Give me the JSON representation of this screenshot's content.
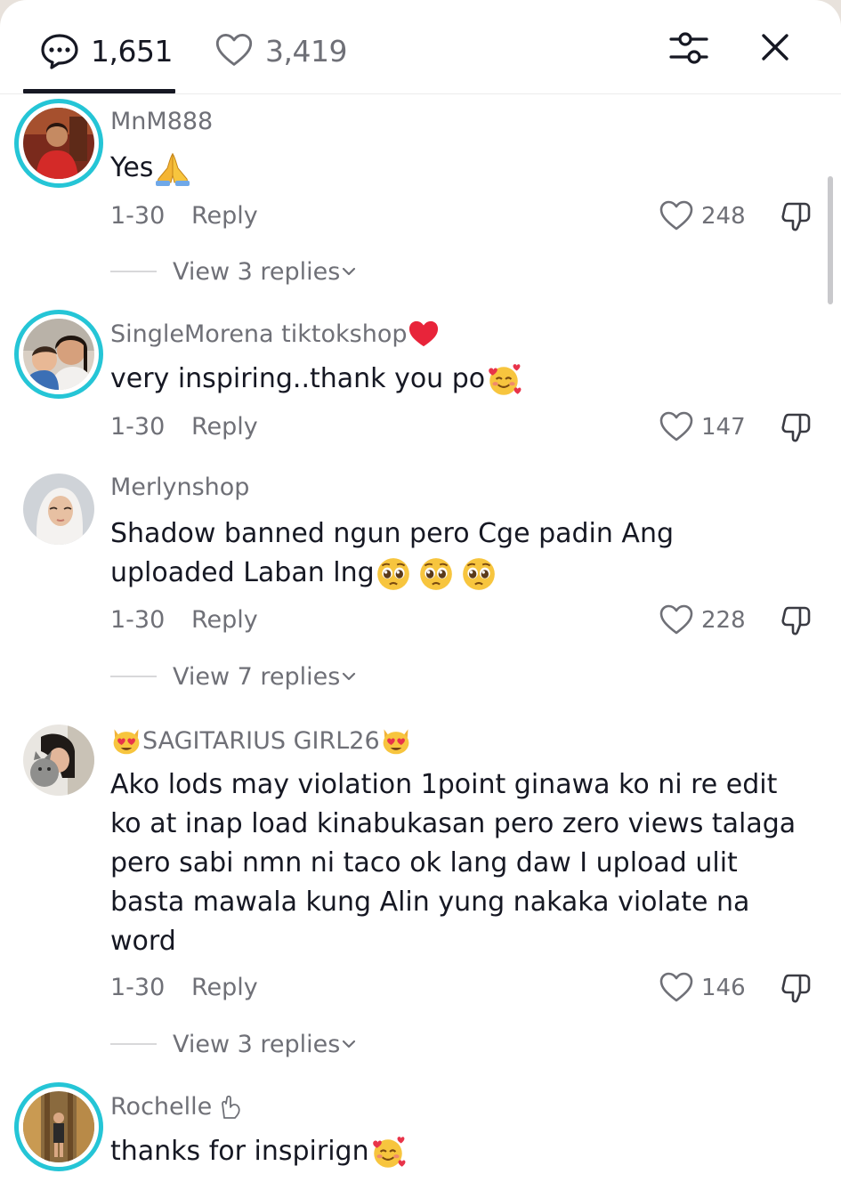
{
  "header": {
    "comments_count": "1,651",
    "likes_count": "3,419",
    "icons": {
      "comments": "comment-bubble-icon",
      "likes": "heart-icon",
      "filter": "sliders-icon",
      "close": "close-icon"
    }
  },
  "comments": [
    {
      "username": "MnM888",
      "text": "Yes",
      "emoji": "folded-hands",
      "date": "1-30",
      "reply_label": "Reply",
      "likes": "248",
      "view_replies": "View 3 replies"
    },
    {
      "username": "SingleMorena tiktokshop",
      "username_emoji": "red-heart",
      "text": "very inspiring..thank you po",
      "emoji": "smiling-face-with-hearts",
      "date": "1-30",
      "reply_label": "Reply",
      "likes": "147"
    },
    {
      "username": "Merlynshop",
      "text_line1": "Shadow banned ngun pero Cge padin Ang",
      "text_line2": "uploaded Laban lng",
      "emoji": "pleading-face x3",
      "date": "1-30",
      "reply_label": "Reply",
      "likes": "228",
      "view_replies": "View 7 replies"
    },
    {
      "username": "SAGITARIUS GIRL26",
      "username_emoji": "heart-eyes-cat",
      "text_lines": [
        "Ako lods may violation 1point ginawa ko ni re edit",
        "ko at inap load kinabukasan pero zero views talaga",
        "pero sabi nmn ni taco ok lang daw I upload ulit",
        "basta mawala kung Alin yung nakaka violate na",
        "word"
      ],
      "date": "1-30",
      "reply_label": "Reply",
      "likes": "146",
      "view_replies": "View 3 replies"
    },
    {
      "username": "Rochelle",
      "username_emoji": "vulcan-salute-outline",
      "text": "thanks for inspirign",
      "emoji": "smiling-face-with-hearts"
    }
  ],
  "colors": {
    "story_ring": "#25c5d6",
    "secondary_text": "#6f7077",
    "primary_text": "#161823"
  }
}
